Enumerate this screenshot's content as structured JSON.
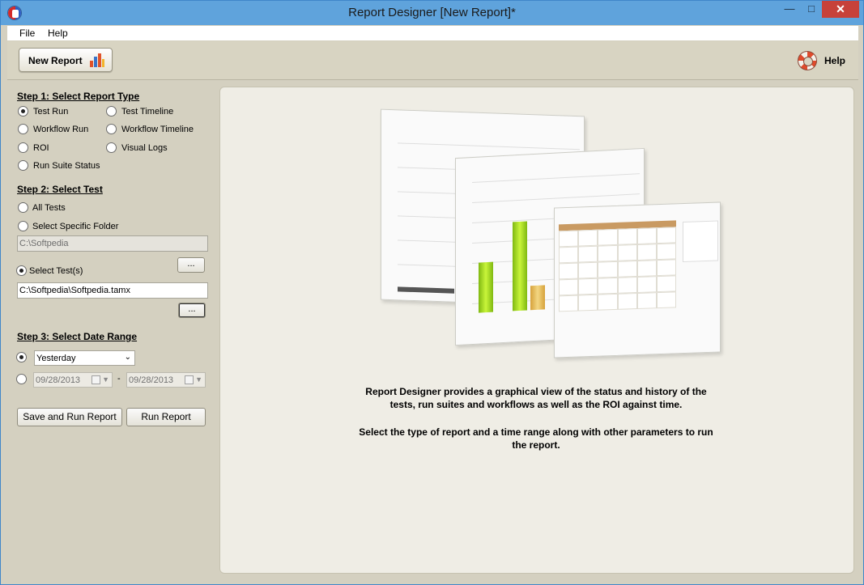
{
  "window": {
    "title": "Report Designer [New Report]*",
    "controls": {
      "minimize": "—",
      "maximize": "□",
      "close": "✕"
    }
  },
  "menu": {
    "file": "File",
    "help": "Help"
  },
  "toolbar": {
    "new_report": "New Report",
    "help": "Help"
  },
  "step1": {
    "title": "Step 1: Select Report Type",
    "options": [
      "Test Run",
      "Test Timeline",
      "Workflow Run",
      "Workflow Timeline",
      "ROI",
      "Visual Logs",
      "Run Suite Status"
    ],
    "selected": "Test Run"
  },
  "step2": {
    "title": "Step 2: Select Test",
    "all_tests": "All Tests",
    "specific_folder": "Select Specific Folder",
    "folder_path": "C:\\Softpedia",
    "select_tests": "Select Test(s)",
    "tests_path": "C:\\Softpedia\\Softpedia.tamx",
    "browse": "...",
    "selected": "Select Test(s)"
  },
  "step3": {
    "title": "Step 3: Select Date Range",
    "range_value": "Yesterday",
    "date_from": "09/28/2013",
    "date_separator": "-",
    "date_to": "09/28/2013"
  },
  "actions": {
    "save_and_run": "Save and Run Report",
    "run": "Run Report"
  },
  "content": {
    "paragraph1": "Report Designer provides a graphical view of the status and history of the tests, run suites and workflows as well as the ROI against time.",
    "paragraph2": "Select the type of report and a time range along with other parameters to run the report."
  },
  "colors": {
    "titlebar": "#5fa3dc",
    "close_button": "#c7413a",
    "panel_bg": "#d4d0c0",
    "content_bg": "#efede5"
  }
}
